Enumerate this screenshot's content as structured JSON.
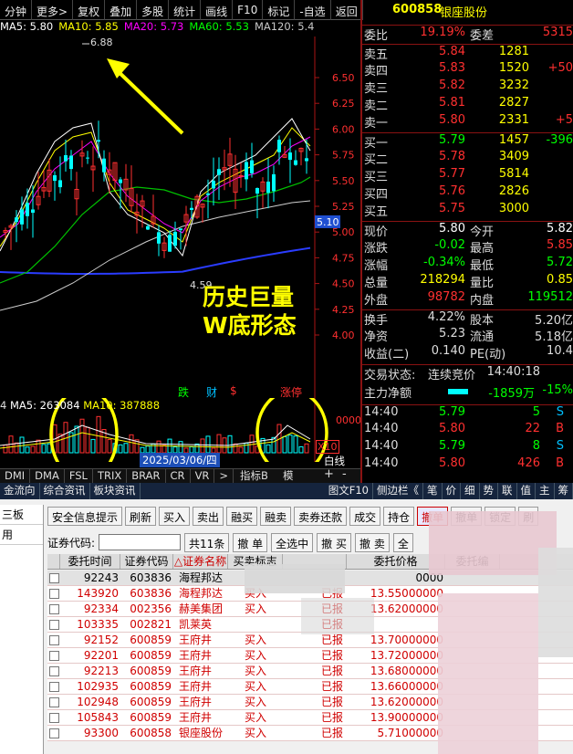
{
  "toolbar": {
    "items": [
      "分钟",
      "更多>",
      "复权",
      "叠加",
      "多股",
      "统计",
      "画线",
      "F10",
      "标记",
      "-自选",
      "返回"
    ]
  },
  "ma_legend": [
    {
      "label": "MA5: 5.80",
      "color": "#ffffff"
    },
    {
      "label": "MA10: 5.85",
      "color": "#ffff00"
    },
    {
      "label": "MA20: 5.73",
      "color": "#ff00ff"
    },
    {
      "label": "MA60: 5.53",
      "color": "#00ff00"
    },
    {
      "label": "MA120: 5.4",
      "color": "#c8c8c8"
    }
  ],
  "price_axis": [
    "6.50",
    "6.25",
    "6.00",
    "5.75",
    "5.50",
    "5.25",
    "5.00",
    "4.75",
    "4.50",
    "4.25",
    "4.00"
  ],
  "high_label": "6.88",
  "low_label": "4.59",
  "current_price_tag": "5.10",
  "annotation": {
    "line1": "历史巨量",
    "line2": "W底形态",
    "color": "#ffff00"
  },
  "markers": {
    "die": "跌",
    "cai": "财",
    "dollar": "$",
    "zhangting": "涨停"
  },
  "vol_legend": {
    "prefix": "4",
    "ma5": "MA5: 263084",
    "ma10": "MA10: 387888"
  },
  "vol_axis": "0000",
  "vol_axis2": "X10",
  "date_tag": "2025/03/06/四",
  "baixian": "白线",
  "indicators": [
    "DMI",
    "DMA",
    "FSL",
    "TRIX",
    "BRAR",
    "CR",
    "VR",
    ">"
  ],
  "zhibiao": "指标B",
  "mo": "模",
  "plusminus": [
    "+",
    "-"
  ],
  "bottom_tabs": [
    "金流向",
    "综合资讯",
    "板块资讯"
  ],
  "right_tabs": [
    "图文F10",
    "侧边栏《",
    "笔",
    "价",
    "细",
    "势",
    "联",
    "值",
    "主",
    "筹"
  ],
  "quote": {
    "code": "600858",
    "name": "银座股份",
    "weibi_label": "委比",
    "weibi": "19.19%",
    "weicha_label": "委差",
    "weicha": "5315",
    "asks": [
      {
        "l": "卖五",
        "p": "5.84",
        "v": "1281",
        "c": ""
      },
      {
        "l": "卖四",
        "p": "5.83",
        "v": "1520",
        "c": "+50"
      },
      {
        "l": "卖三",
        "p": "5.82",
        "v": "3232",
        "c": ""
      },
      {
        "l": "卖二",
        "p": "5.81",
        "v": "2827",
        "c": ""
      },
      {
        "l": "卖一",
        "p": "5.80",
        "v": "2331",
        "c": "+5"
      }
    ],
    "bids": [
      {
        "l": "买一",
        "p": "5.79",
        "v": "1457",
        "c": "-396"
      },
      {
        "l": "买二",
        "p": "5.78",
        "v": "3409",
        "c": ""
      },
      {
        "l": "买三",
        "p": "5.77",
        "v": "5814",
        "c": ""
      },
      {
        "l": "买四",
        "p": "5.76",
        "v": "2826",
        "c": ""
      },
      {
        "l": "买五",
        "p": "5.75",
        "v": "3000",
        "c": ""
      }
    ],
    "stats": [
      {
        "l1": "现价",
        "v1": "5.80",
        "c1": "#ffffff",
        "l2": "今开",
        "v2": "5.82",
        "c2": "#ffffff"
      },
      {
        "l1": "涨跌",
        "v1": "-0.02",
        "c1": "#00ff00",
        "l2": "最高",
        "v2": "5.85",
        "c2": "#ff3030"
      },
      {
        "l1": "涨幅",
        "v1": "-0.34%",
        "c1": "#00ff00",
        "l2": "最低",
        "v2": "5.72",
        "c2": "#00ff00"
      },
      {
        "l1": "总量",
        "v1": "218294",
        "c1": "#ffff00",
        "l2": "量比",
        "v2": "0.85",
        "c2": "#ffff00"
      },
      {
        "l1": "外盘",
        "v1": "98782",
        "c1": "#ff3030",
        "l2": "内盘",
        "v2": "119512",
        "c2": "#00ff00"
      }
    ],
    "stats2": [
      {
        "l1": "换手",
        "v1": "4.22%",
        "l2": "股本",
        "v2": "5.20亿"
      },
      {
        "l1": "净资",
        "v1": "5.23",
        "l2": "流通",
        "v2": "5.18亿"
      },
      {
        "l1": "收益(二)",
        "v1": "0.140",
        "l2": "PE(动)",
        "v2": "10.4"
      }
    ],
    "trade_status_label": "交易状态:",
    "trade_status": "连续竞价",
    "trade_time": "14:40:18",
    "main_flow_label": "主力净额",
    "main_flow": "-1859万",
    "main_flow_pct": "-15%",
    "ticks": [
      {
        "t": "14:40",
        "p": "5.79",
        "v": "5",
        "s": "S"
      },
      {
        "t": "14:40",
        "p": "5.80",
        "v": "22",
        "s": "B"
      },
      {
        "t": "14:40",
        "p": "5.79",
        "v": "8",
        "s": "S"
      },
      {
        "t": "14:40",
        "p": "5.80",
        "v": "426",
        "s": "B"
      }
    ]
  },
  "left_menu": [
    "三板",
    "用"
  ],
  "trade_buttons": [
    "安全信息提示",
    "刷新",
    "买入",
    "卖出",
    "融买",
    "融卖",
    "卖券还款",
    "成交",
    "持仓",
    "撤单",
    "撤单",
    "锁定",
    "刷"
  ],
  "code_label": "证券代码:",
  "code_buttons": [
    "共11条",
    "撤 单",
    "全选中",
    "撤 买",
    "撤 卖",
    "全"
  ],
  "grid_headers": [
    "委托时间",
    "证券代码",
    "△证券名称",
    "买卖标志",
    "",
    "委托价格",
    "委托编"
  ],
  "orders": [
    {
      "time": "92243",
      "code": "603836",
      "name": "海程邦达",
      "side": "",
      "status": "",
      "price": "0000",
      "color": "#000000",
      "sel": true
    },
    {
      "time": "143920",
      "code": "603836",
      "name": "海程邦达",
      "side": "买入",
      "status": "已报",
      "price": "13.55000000",
      "color": "#d00000"
    },
    {
      "time": "92334",
      "code": "002356",
      "name": "赫美集团",
      "side": "买入",
      "status": "已报",
      "price": "13.62000000",
      "color": "#d00000"
    },
    {
      "time": "103335",
      "code": "002821",
      "name": "凯莱英",
      "side": "",
      "status": "已报",
      "price": "",
      "color": "#d00000"
    },
    {
      "time": "92152",
      "code": "600859",
      "name": "王府井",
      "side": "买入",
      "status": "已报",
      "price": "13.70000000",
      "color": "#d00000"
    },
    {
      "time": "92201",
      "code": "600859",
      "name": "王府井",
      "side": "买入",
      "status": "已报",
      "price": "13.72000000",
      "color": "#d00000"
    },
    {
      "time": "92213",
      "code": "600859",
      "name": "王府井",
      "side": "买入",
      "status": "已报",
      "price": "13.68000000",
      "color": "#d00000"
    },
    {
      "time": "102935",
      "code": "600859",
      "name": "王府井",
      "side": "买入",
      "status": "已报",
      "price": "13.66000000",
      "color": "#d00000"
    },
    {
      "time": "102948",
      "code": "600859",
      "name": "王府井",
      "side": "买入",
      "status": "已报",
      "price": "13.62000000",
      "color": "#d00000"
    },
    {
      "time": "105843",
      "code": "600859",
      "name": "王府井",
      "side": "买入",
      "status": "已报",
      "price": "13.90000000",
      "color": "#d00000"
    },
    {
      "time": "93300",
      "code": "600858",
      "name": "银座股份",
      "side": "买入",
      "status": "已报",
      "price": "5.71000000",
      "color": "#d00000"
    }
  ]
}
